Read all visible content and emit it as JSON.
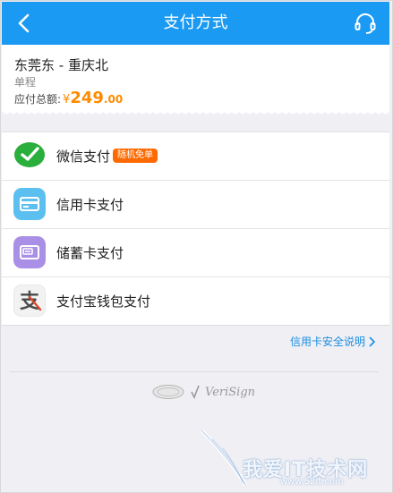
{
  "header": {
    "title": "支付方式",
    "bg_color": "#1a9af2",
    "back_icon": "chevron-left-icon",
    "service_icon": "headset-icon"
  },
  "order": {
    "route": "东莞东 - 重庆北",
    "trip_type": "单程",
    "total_label": "应付总额:",
    "currency": "¥",
    "amount_int": "249",
    "amount_dec": ".00",
    "accent_color": "#ff8a00"
  },
  "payment_methods": [
    {
      "label": "微信支付",
      "icon": "wechat-pay-icon",
      "badge": "随机免单"
    },
    {
      "label": "信用卡支付",
      "icon": "credit-card-icon"
    },
    {
      "label": "储蓄卡支付",
      "icon": "debit-card-icon"
    },
    {
      "label": "支付宝钱包支付",
      "icon": "alipay-icon"
    }
  ],
  "security_link": "信用卡安全说明",
  "certifications": {
    "right_label": "VeriSign"
  },
  "watermark": {
    "text": "我爱IT技术网",
    "url": "www.52it.com"
  }
}
